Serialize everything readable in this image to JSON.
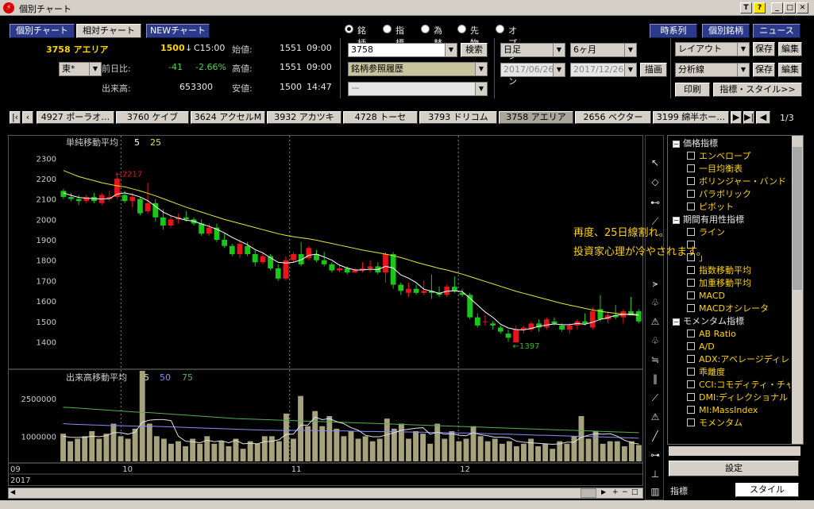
{
  "window": {
    "title": "個別チャート",
    "btn_help": "?"
  },
  "toolbar": {
    "nav_tabs": [
      "個別チャート",
      "相対チャート",
      "NEWチャート"
    ],
    "radios": [
      "銘柄",
      "指標",
      "為替",
      "先物",
      "オプション"
    ],
    "right_buttons": [
      "時系列",
      "個別銘柄",
      "ニュース"
    ],
    "search_button": "検索",
    "draw_button": "描画",
    "save_label": "保存",
    "edit_label": "編集",
    "print_button": "印刷",
    "style_button": "指標・スタイル>>"
  },
  "quote": {
    "code_name": "3758 アエリア",
    "price": "1500",
    "arrow": "↓",
    "status": "C15:00",
    "exchange": "東*",
    "prev_label": "前日比:",
    "change": "-41",
    "change_pct": "-2.66%",
    "volume_label": "出来高:",
    "volume": "653300",
    "open_label": "始値:",
    "open": "1551",
    "open_time": "09:00",
    "high_label": "高値:",
    "high": "1551",
    "high_time": "09:00",
    "low_label": "安値:",
    "low": "1500",
    "low_time": "14:47"
  },
  "inputs": {
    "code": "3758",
    "history": "銘柄参照履歴",
    "sub": "ー",
    "period": "日足",
    "range": "6ヶ月",
    "date_from": "2017/06/26",
    "date_to": "2017/12/26",
    "layout": "レイアウト",
    "analysis": "分析線"
  },
  "stock_tabs": [
    {
      "label": "4927 ポーラオ…",
      "active": false
    },
    {
      "label": "3760 ケイブ",
      "active": false
    },
    {
      "label": "3624 アクセルM",
      "active": false
    },
    {
      "label": "3932 アカツキ",
      "active": false
    },
    {
      "label": "4728 トーセ",
      "active": false
    },
    {
      "label": "3793 ドリコム",
      "active": false
    },
    {
      "label": "3758 アエリア",
      "active": true
    },
    {
      "label": "2656 ベクター",
      "active": false
    },
    {
      "label": "3199 綿半ホー…",
      "active": false
    }
  ],
  "stock_tab_page": "1/3",
  "chart_data": {
    "type": "candlestick",
    "price_panel": {
      "legend_label": "単純移動平均",
      "ma_periods": [
        "5",
        "25"
      ],
      "y_ticks": [
        2300,
        2200,
        2100,
        2000,
        1900,
        1800,
        1700,
        1600,
        1500,
        1400
      ],
      "ylim": [
        1320,
        2340
      ],
      "high_marker": "←2217",
      "low_marker": "←1397",
      "candles": [
        [
          2140,
          2150,
          2100,
          2110
        ],
        [
          2110,
          2130,
          2090,
          2100
        ],
        [
          2100,
          2120,
          2070,
          2090
        ],
        [
          2090,
          2120,
          2080,
          2110
        ],
        [
          2110,
          2130,
          2080,
          2090
        ],
        [
          2080,
          2130,
          2070,
          2120
        ],
        [
          2100,
          2140,
          2090,
          2110
        ],
        [
          2110,
          2217,
          2100,
          2200
        ],
        [
          2120,
          2140,
          2080,
          2090
        ],
        [
          2090,
          2130,
          2060,
          2110
        ],
        [
          2100,
          2110,
          2020,
          2030
        ],
        [
          2040,
          2180,
          2030,
          2080
        ],
        [
          2080,
          2100,
          1990,
          2010
        ],
        [
          2010,
          2050,
          1950,
          1970
        ],
        [
          1970,
          2020,
          1960,
          2000
        ],
        [
          2000,
          2030,
          1980,
          2010
        ],
        [
          2010,
          2040,
          1990,
          2000
        ],
        [
          2000,
          2010,
          1970,
          1980
        ],
        [
          1980,
          2000,
          1920,
          1930
        ],
        [
          1930,
          1980,
          1920,
          1960
        ],
        [
          1960,
          1980,
          1890,
          1900
        ],
        [
          1900,
          1930,
          1860,
          1870
        ],
        [
          1870,
          1880,
          1820,
          1830
        ],
        [
          1830,
          1900,
          1810,
          1880
        ],
        [
          1870,
          1890,
          1820,
          1830
        ],
        [
          1830,
          1850,
          1770,
          1790
        ],
        [
          1790,
          1840,
          1780,
          1820
        ],
        [
          1820,
          1830,
          1750,
          1760
        ],
        [
          1760,
          1780,
          1700,
          1710
        ],
        [
          1710,
          1820,
          1700,
          1800
        ],
        [
          1800,
          1840,
          1790,
          1830
        ],
        [
          1830,
          1890,
          1770,
          1780
        ],
        [
          1810,
          1870,
          1800,
          1860
        ],
        [
          1830,
          1850,
          1790,
          1800
        ],
        [
          1800,
          1840,
          1770,
          1780
        ],
        [
          1780,
          1790,
          1740,
          1750
        ],
        [
          1750,
          1780,
          1740,
          1760
        ],
        [
          1760,
          1770,
          1730,
          1740
        ],
        [
          1740,
          1760,
          1740,
          1750
        ],
        [
          1750,
          1790,
          1740,
          1760
        ],
        [
          1760,
          1800,
          1740,
          1770
        ],
        [
          1770,
          1790,
          1730,
          1740
        ],
        [
          1740,
          1840,
          1690,
          1830
        ],
        [
          1830,
          1840,
          1660,
          1680
        ],
        [
          1680,
          1690,
          1630,
          1650
        ],
        [
          1640,
          1690,
          1620,
          1660
        ],
        [
          1660,
          1680,
          1630,
          1640
        ],
        [
          1640,
          1700,
          1630,
          1650
        ],
        [
          1650,
          1730,
          1610,
          1640
        ],
        [
          1640,
          1670,
          1620,
          1630
        ],
        [
          1630,
          1680,
          1620,
          1670
        ],
        [
          1670,
          1720,
          1640,
          1650
        ],
        [
          1640,
          1660,
          1620,
          1630
        ],
        [
          1630,
          1640,
          1510,
          1520
        ],
        [
          1520,
          1540,
          1470,
          1480
        ],
        [
          1500,
          1530,
          1480,
          1500
        ],
        [
          1490,
          1500,
          1460,
          1480
        ],
        [
          1470,
          1480,
          1440,
          1450
        ],
        [
          1440,
          1460,
          1400,
          1420
        ],
        [
          1397,
          1480,
          1397,
          1460
        ],
        [
          1460,
          1480,
          1440,
          1470
        ],
        [
          1460,
          1500,
          1450,
          1490
        ],
        [
          1490,
          1510,
          1450,
          1470
        ],
        [
          1470,
          1520,
          1460,
          1510
        ],
        [
          1500,
          1520,
          1480,
          1490
        ],
        [
          1480,
          1490,
          1450,
          1460
        ],
        [
          1460,
          1490,
          1440,
          1480
        ],
        [
          1480,
          1510,
          1460,
          1500
        ],
        [
          1500,
          1540,
          1480,
          1490
        ],
        [
          1470,
          1570,
          1460,
          1550
        ],
        [
          1560,
          1630,
          1500,
          1510
        ],
        [
          1510,
          1550,
          1490,
          1530
        ],
        [
          1530,
          1580,
          1510,
          1520
        ],
        [
          1520,
          1560,
          1490,
          1550
        ],
        [
          1550,
          1620,
          1530,
          1530
        ],
        [
          1550,
          1560,
          1490,
          1500
        ]
      ],
      "ma25": [
        2240,
        2225,
        2210,
        2200,
        2190,
        2180,
        2172,
        2165,
        2160,
        2150,
        2140,
        2128,
        2116,
        2102,
        2088,
        2074,
        2060,
        2048,
        2036,
        2024,
        2012,
        2000,
        1990,
        1980,
        1970,
        1960,
        1950,
        1940,
        1930,
        1922,
        1915,
        1910,
        1905,
        1898,
        1890,
        1882,
        1874,
        1866,
        1858,
        1850,
        1843,
        1837,
        1830,
        1822,
        1813,
        1802,
        1790,
        1780,
        1770,
        1760,
        1752,
        1742,
        1732,
        1720,
        1708,
        1696,
        1684,
        1672,
        1660,
        1648,
        1638,
        1628,
        1618,
        1608,
        1598,
        1588,
        1580,
        1572,
        1564,
        1556,
        1550,
        1544,
        1540,
        1536,
        1532,
        1530
      ],
      "ma5": [
        2130,
        2118,
        2108,
        2104,
        2102,
        2100,
        2102,
        2124,
        2130,
        2122,
        2110,
        2092,
        2064,
        2036,
        2018,
        2006,
        1996,
        1992,
        1978,
        1966,
        1952,
        1934,
        1912,
        1894,
        1876,
        1852,
        1836,
        1812,
        1790,
        1786,
        1790,
        1802,
        1824,
        1830,
        1816,
        1800,
        1776,
        1762,
        1752,
        1752,
        1756,
        1754,
        1770,
        1762,
        1728,
        1712,
        1690,
        1658,
        1648,
        1638,
        1648,
        1650,
        1646,
        1614,
        1580,
        1546,
        1520,
        1486,
        1468,
        1460,
        1458,
        1466,
        1476,
        1482,
        1488,
        1484,
        1484,
        1490,
        1486,
        1496,
        1510,
        1518,
        1530,
        1534,
        1536,
        1532
      ]
    },
    "volume_panel": {
      "legend_label": "出来高移動平均",
      "ma_periods": [
        "5",
        "50",
        "75"
      ],
      "y_ticks": [
        "2500000",
        "1000000"
      ],
      "ylim": [
        0,
        3600000
      ],
      "volumes": [
        1100000,
        800000,
        900000,
        1000000,
        1200000,
        900000,
        1100000,
        1500000,
        1000000,
        900000,
        1300000,
        3600000,
        1500000,
        1000000,
        900000,
        700000,
        800000,
        600000,
        900000,
        700000,
        1000000,
        700000,
        800000,
        600000,
        900000,
        500000,
        800000,
        700000,
        1000000,
        1000000,
        800000,
        1900000,
        900000,
        2600000,
        1400000,
        2000000,
        1400000,
        1800000,
        1300000,
        1000000,
        1200000,
        900000,
        1000000,
        800000,
        900000,
        1700000,
        1300000,
        1500000,
        900000,
        1200000,
        1100000,
        700000,
        1500000,
        900000,
        1200000,
        800000,
        900000,
        1400000,
        1000000,
        800000,
        900000,
        700000,
        800000,
        600000,
        700000,
        900000,
        600000,
        700000,
        500000,
        800000,
        700000,
        1000000,
        1800000,
        900000,
        1200000,
        700000,
        800000,
        800000,
        600000,
        800000,
        650000
      ],
      "ma5": [
        1000000,
        960000,
        950000,
        960000,
        1000000,
        980000,
        1020000,
        1140000,
        1140000,
        1080000,
        1160000,
        1560000,
        1640000,
        1660000,
        1660000,
        1620000,
        1000000,
        800000,
        780000,
        740000,
        840000,
        780000,
        820000,
        740000,
        840000,
        700000,
        720000,
        700000,
        780000,
        800000,
        860000,
        1080000,
        1080000,
        1440000,
        1440000,
        1760000,
        1660000,
        1700000,
        1580000,
        1500000,
        1340000,
        1240000,
        1040000,
        980000,
        980000,
        1060000,
        1140000,
        1240000,
        1280000,
        1320000,
        1340000,
        1080000,
        1160000,
        1080000,
        1100000,
        1040000,
        1020000,
        1140000,
        1060000,
        1020000,
        960000,
        960000,
        940000,
        800000,
        760000,
        740000,
        720000,
        700000,
        680000,
        700000,
        760000,
        760000,
        960000,
        1040000,
        1100000,
        1080000,
        1100000,
        1000000,
        840000,
        740000,
        690000
      ],
      "ma50": [
        1500000,
        1480000,
        1470000,
        1460000,
        1450000,
        1440000,
        1430000,
        1420000,
        1420000,
        1410000,
        1400000,
        1400000,
        1400000,
        1390000,
        1380000,
        1370000,
        1360000,
        1350000,
        1340000,
        1330000,
        1320000,
        1310000,
        1300000,
        1290000,
        1280000,
        1270000,
        1260000,
        1250000,
        1240000,
        1240000,
        1230000,
        1230000,
        1230000,
        1230000,
        1230000,
        1220000,
        1220000,
        1220000,
        1210000,
        1210000,
        1200000,
        1200000,
        1190000,
        1190000,
        1180000,
        1180000,
        1180000,
        1170000,
        1170000,
        1160000,
        1160000,
        1150000,
        1150000,
        1140000,
        1140000,
        1130000,
        1130000,
        1120000,
        1110000,
        1100000,
        1090000,
        1080000,
        1080000,
        1070000,
        1060000,
        1050000,
        1040000,
        1040000,
        1030000,
        1020000,
        1010000,
        1000000,
        1000000,
        990000,
        980000,
        970000,
        960000,
        950000,
        940000,
        930000,
        920000
      ],
      "ma75": [
        2150000,
        2140000,
        2120000,
        2100000,
        2080000,
        2060000,
        2040000,
        2020000,
        2000000,
        1980000,
        1960000,
        1950000,
        1940000,
        1920000,
        1900000,
        1880000,
        1860000,
        1840000,
        1820000,
        1800000,
        1780000,
        1760000,
        1740000,
        1720000,
        1700000,
        1690000,
        1680000,
        1670000,
        1660000,
        1650000,
        1640000,
        1630000,
        1620000,
        1610000,
        1600000,
        1590000,
        1580000,
        1570000,
        1560000,
        1550000,
        1540000,
        1530000,
        1520000,
        1510000,
        1500000,
        1490000,
        1480000,
        1470000,
        1460000,
        1450000,
        1440000,
        1430000,
        1420000,
        1410000,
        1400000,
        1390000,
        1380000,
        1370000,
        1360000,
        1350000,
        1340000,
        1330000,
        1320000,
        1310000,
        1300000,
        1290000,
        1280000,
        1270000,
        1260000,
        1250000,
        1240000,
        1230000,
        1220000,
        1210000,
        1200000,
        1190000,
        1180000,
        1170000,
        1160000,
        1150000,
        1140000
      ]
    },
    "x_labels": [
      {
        "label": "09",
        "index": 0
      },
      {
        "label": "10",
        "index": 5
      },
      {
        "label": "11",
        "index": 27
      },
      {
        "label": "12",
        "index": 49
      }
    ],
    "year_label": "2017",
    "colors": {
      "up": "#e8141c",
      "down": "#19c619",
      "ma_short": "#ffffff",
      "ma_long": "#e6e636",
      "vol_bar": "#a6a27c",
      "vol_ma5": "#e0e0e0",
      "vol_ma50": "#8a8aff",
      "vol_ma75": "#53b053"
    }
  },
  "annotation": [
    "再度、25日線割れ。",
    "投資家心理が冷やされます。"
  ],
  "indicator_tree": [
    {
      "kind": "cat",
      "label": "価格指標"
    },
    {
      "kind": "item",
      "label": "エンベロープ"
    },
    {
      "kind": "item",
      "label": "一目均衡表"
    },
    {
      "kind": "item",
      "label": "ボリンジャー・バンド"
    },
    {
      "kind": "item",
      "label": "パラボリック"
    },
    {
      "kind": "item",
      "label": "ピボット"
    },
    {
      "kind": "cat",
      "label": "期間有用性指標"
    },
    {
      "kind": "item",
      "label": "ライン"
    },
    {
      "kind": "item",
      "label": ""
    },
    {
      "kind": "item",
      "label": "」"
    },
    {
      "kind": "item",
      "label": "指数移動平均"
    },
    {
      "kind": "item",
      "label": "加重移動平均"
    },
    {
      "kind": "item",
      "label": "MACD"
    },
    {
      "kind": "item",
      "label": "MACDオシレータ"
    },
    {
      "kind": "cat",
      "label": "モメンタム指標"
    },
    {
      "kind": "item",
      "label": "AB Ratio"
    },
    {
      "kind": "item",
      "label": "A/D"
    },
    {
      "kind": "item",
      "label": "ADX:アベレージディレ"
    },
    {
      "kind": "item",
      "label": "乖離度"
    },
    {
      "kind": "item",
      "label": "CCI:コモディティ・チャ"
    },
    {
      "kind": "item",
      "label": "DMI:ディレクショナル"
    },
    {
      "kind": "item",
      "label": "MI:MassIndex"
    },
    {
      "kind": "item",
      "label": "モメンタム"
    }
  ],
  "side_buttons": {
    "settings": "設定"
  },
  "bottom_tabs": [
    "指標",
    "スタイル"
  ],
  "tool_icons": [
    "cursor-icon",
    "eraser-icon",
    "hline-icon",
    "trendline-icon",
    "fan-icon",
    "fib-icon",
    "channel-icon",
    "gann-icon",
    "cycle-icon",
    "arrow-icon",
    "gann-fan-icon",
    "regression-icon",
    "grid-icon",
    "level-icon"
  ]
}
